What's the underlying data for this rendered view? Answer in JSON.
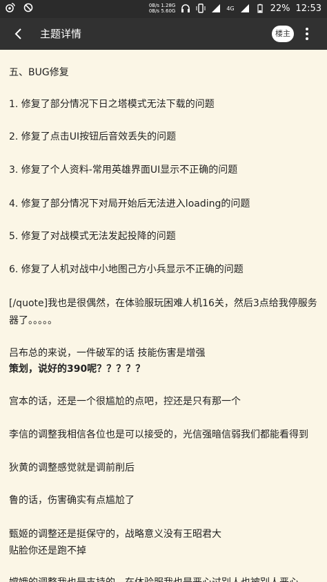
{
  "status_bar": {
    "speed_up": "0B/s",
    "speed_down": "0B/s",
    "data_up": "1.28G",
    "data_down": "5.60G",
    "network": "4G",
    "battery": "22%",
    "time": "12:53"
  },
  "app_bar": {
    "title": "主题详情",
    "owner_button": "楼主"
  },
  "content": {
    "lines": [
      "五、BUG修复",
      "1. 修复了部分情况下日之塔模式无法下载的问题",
      "2. 修复了点击UI按钮后音效丢失的问题",
      "3. 修复了个人资料-常用英雄界面UI显示不正确的问题",
      "4. 修复了部分情况下对局开始后无法进入loading的问题",
      "5. 修复了对战模式无法发起投降的问题",
      "6. 修复了人机对战中小地图己方小兵显示不正确的问题",
      "[/quote]我也是很偶然，在体验服玩困难人机16关，然后3点给我停服务",
      "器了。。。。。",
      "吕布总的来说，一件破军的话 技能伤害是增强",
      "策划，说好的390呢？？？？？",
      "宫本的话，还是一个很尴尬的点吧，控还是只有那一个",
      "李信的调整我相信各位也是可以接受的，光信强暗信弱我们都能看得到",
      "狄黄的调整感觉就是调前削后",
      "鲁的话，伤害确实有点尴尬了",
      "甄姬的调整还是挺保守的，战略意义没有王昭君大",
      "贴脸你还是跑不掉",
      "嫦娥的调整我也是支持的，在体验服我也是恶心过别人也被别人恶心"
    ]
  }
}
